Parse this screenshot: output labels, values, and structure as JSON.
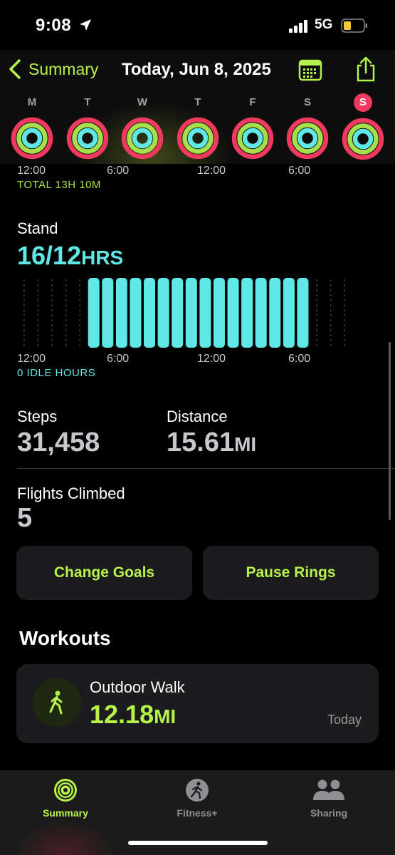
{
  "status": {
    "time": "9:08",
    "network": "5G"
  },
  "header": {
    "back_label": "Summary",
    "title": "Today, Jun 8, 2025"
  },
  "week": [
    {
      "letter": "M",
      "today": false
    },
    {
      "letter": "T",
      "today": false
    },
    {
      "letter": "W",
      "today": false
    },
    {
      "letter": "T",
      "today": false
    },
    {
      "letter": "F",
      "today": false
    },
    {
      "letter": "S",
      "today": false
    },
    {
      "letter": "S",
      "today": true
    }
  ],
  "axis_labels": [
    "12:00",
    "6:00",
    "12:00",
    "6:00"
  ],
  "exercise_total": "TOTAL 13H 10M",
  "stand": {
    "label": "Stand",
    "value": "16/12",
    "unit": "HRS",
    "idle": "0 IDLE HOURS"
  },
  "stats": {
    "steps_label": "Steps",
    "steps_value": "31,458",
    "distance_label": "Distance",
    "distance_value": "15.61",
    "distance_unit": "MI",
    "flights_label": "Flights Climbed",
    "flights_value": "5"
  },
  "buttons": {
    "change_goals": "Change Goals",
    "pause_rings": "Pause Rings"
  },
  "workouts": {
    "title": "Workouts",
    "items": [
      {
        "name": "Outdoor Walk",
        "distance": "12.18",
        "unit": "MI",
        "when": "Today"
      }
    ]
  },
  "tabs": [
    {
      "label": "Summary",
      "icon": "activity-rings-icon",
      "active": true
    },
    {
      "label": "Fitness+",
      "icon": "fitness-plus-icon",
      "active": false
    },
    {
      "label": "Sharing",
      "icon": "people-icon",
      "active": false
    }
  ],
  "colors": {
    "accent": "#b6f24a",
    "move": "#f0395e",
    "exercise": "#a5e04a",
    "stand": "#5fe8e6"
  }
}
